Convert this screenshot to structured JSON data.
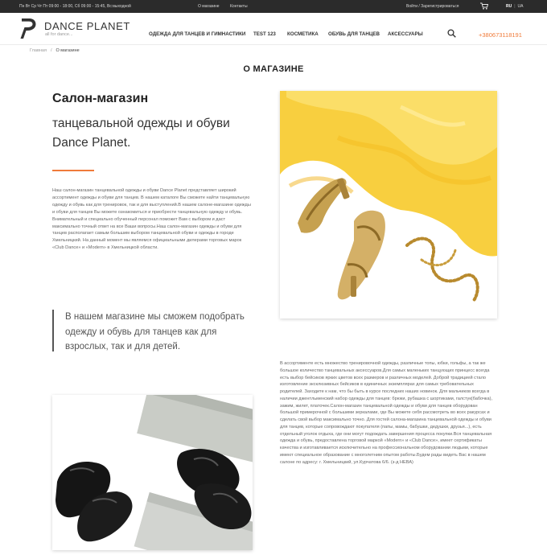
{
  "topbar": {
    "hours": "Пн Вт Ср Чт Пт 09:00 - 18:00, Сб 09:00 - 15:45, Вс:выходной",
    "links": [
      "О магазине",
      "Контакты"
    ],
    "auth": "Войти / Зарегистрироваться",
    "lang_active": "RU",
    "lang_other": "UA"
  },
  "header": {
    "brand": "DANCE PLANET",
    "tagline": "all for dance...",
    "nav": [
      "ОДЕЖДА ДЛЯ ТАНЦЕВ И ГИМНАСТИКИ",
      "TEST 123",
      "КОСМЕТИКА",
      "ОБУВЬ ДЛЯ ТАНЦЕВ",
      "АКСЕССУАРЫ"
    ],
    "phone": "+380673118191"
  },
  "breadcrumb": {
    "home": "Главная",
    "current": "О магазине"
  },
  "page_title": "О МАГАЗИНЕ",
  "intro": {
    "title": "Салон-магазин",
    "subtitle": "танцевальной одежды и обуви Dance Planet.",
    "text": "Наш салон-магазин танцевальной одежды и обуви Dance Planet представляет широкий ассортимент одежды и обуви для танцев. В нашем каталоге Вы сможете найти танцевальную одежду и обувь как для тренировок, так и для выступлений.В нашем салоне-магазине одежды и обуви для танцев Вы можете ознакомиться и приобрести танцевальную одежду и обувь. Внимательный и специально обученный персонал поможет Вам с выбором и даст максимально точный ответ на все Ваши вопросы.Наш салон-магазин одежды и обуви для танцев располагает самым большим выбором танцевальной обуви и одежды в городе Хмельницкий. На данный момент мы являемся официальными дилерами торговых марок «Club Dance» и «Modern» в Хмельницкой области."
  },
  "quote": "В нашем магазине мы сможем подобрать одежду и обувь для танцев как для взрослых, так и для детей.",
  "assortment": "В ассортименте есть множество тренировочной одежды, различные топы, юбки, гольфы, а так же большое количество танцевальных аксессуаров.Для самых маленьких танцующих принцесс всегда есть выбор бейсиков ярких цветов всех размеров и различных моделей. Доброй традицией стало изготовление эксклюзивных бейсиков в единичных экземплярах для самых требовательных родителей. Заходите к нам, что бы быть в курсе последних наших новинок. Для мальчиков всегда в наличии джентльменский набор одежды для танцев: брюки, рубашка с шортиками, галстук(бабочка), зажим, жилет, платочек.Салон-магазин танцевальной одежды и обуви для танцев оборудован большой примерочной с большими зеркалами, где Вы можете себя рассмотреть во всех ракурсах и сделать свой выбор максимально точно. Для гостей салона-магазина танцевальной одежды и обуви для танцев, которые сопровождают покупателя (папы, мамы, бабушки, дедушки, друзья...), есть отдельный уголок отдыха, где они могут подождать завершения процесса покупки.Вся танцевальная одежда и обувь, предоставлена торговой маркой «Modern» и «Club Dance», имеет сертификаты качества и изготавливается исключительно на профессиональном оборудовании людьми, которые имеют специальное образование с многолетним опытом работы.Будем рады видеть Вас в нашем салоне по адресу: г. Хмельницкий, ул.Курчатова 6/6. (з-д НЕВА)",
  "colors": {
    "accent": "#f07b3a",
    "topbar": "#2b2b2b"
  },
  "icons": [
    "logo-mark-icon",
    "cart-icon",
    "search-icon"
  ]
}
